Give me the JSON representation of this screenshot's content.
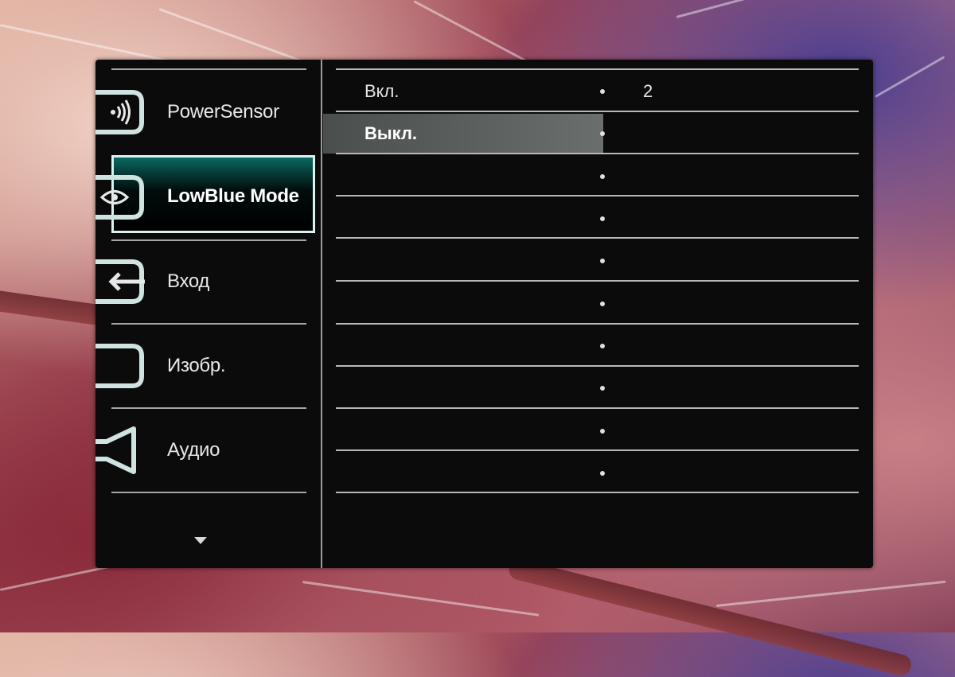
{
  "sidebar": {
    "items": [
      {
        "label": "PowerSensor",
        "icon": "powersensor-icon",
        "selected": false
      },
      {
        "label": "LowBlue Mode",
        "icon": "eye-icon",
        "selected": true
      },
      {
        "label": "Вход",
        "icon": "input-icon",
        "selected": false
      },
      {
        "label": "Изобр.",
        "icon": "picture-icon",
        "selected": false
      },
      {
        "label": "Аудио",
        "icon": "speaker-icon",
        "selected": false
      }
    ],
    "more_icon": "chevron-down-icon"
  },
  "submenu": {
    "rows": [
      {
        "label": "Вкл.",
        "value": "2",
        "highlighted": false
      },
      {
        "label": "Выкл.",
        "value": "",
        "highlighted": true
      },
      {
        "label": "",
        "value": "",
        "highlighted": false
      },
      {
        "label": "",
        "value": "",
        "highlighted": false
      },
      {
        "label": "",
        "value": "",
        "highlighted": false
      },
      {
        "label": "",
        "value": "",
        "highlighted": false
      },
      {
        "label": "",
        "value": "",
        "highlighted": false
      },
      {
        "label": "",
        "value": "",
        "highlighted": false
      },
      {
        "label": "",
        "value": "",
        "highlighted": false
      },
      {
        "label": "",
        "value": "",
        "highlighted": false
      }
    ]
  },
  "colors": {
    "selection_border": "#d9f2ef",
    "selection_accent": "#0a6a62",
    "row_highlight": "#5d6261"
  }
}
